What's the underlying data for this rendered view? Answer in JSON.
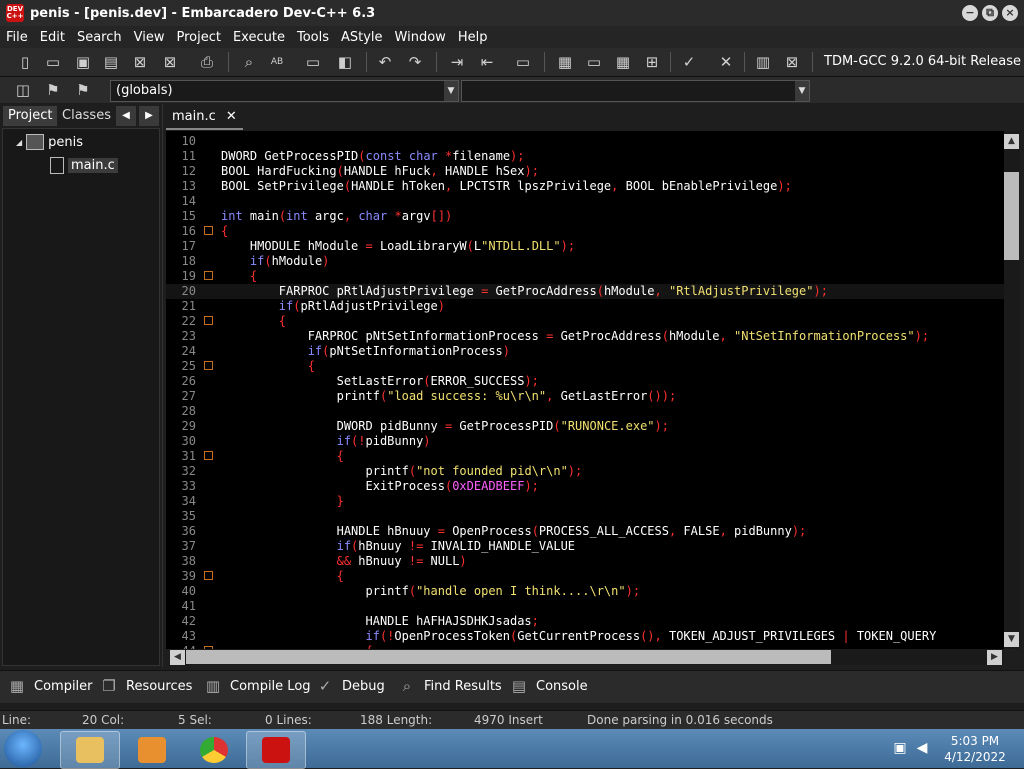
{
  "window": {
    "icon_text": "DEV C++",
    "title": "penis - [penis.dev] - Embarcadero Dev-C++ 6.3"
  },
  "menu": [
    "File",
    "Edit",
    "Search",
    "View",
    "Project",
    "Execute",
    "Tools",
    "AStyle",
    "Window",
    "Help"
  ],
  "toolbar": {
    "compiler": "TDM-GCC 9.2.0 64-bit Release",
    "icons": [
      "new-file-icon",
      "open-icon",
      "save-icon",
      "save-all-icon",
      "close-icon",
      "close-all-icon",
      "print-icon",
      "search-icon",
      "replace-icon",
      "goto-icon",
      "toggle-icon",
      "undo-icon",
      "redo-icon",
      "indent-icon",
      "unindent-icon",
      "comment-icon",
      "grid-icon",
      "window-icon",
      "tile-icon",
      "class-icon",
      "check-icon",
      "cross-icon",
      "chart-icon",
      "delete-icon"
    ]
  },
  "toolbar2": {
    "globals_value": "(globals)"
  },
  "left_panel": {
    "tabs": [
      "Project",
      "Classes"
    ],
    "tree": {
      "root": "penis",
      "child": "main.c"
    }
  },
  "editor": {
    "tab": "main.c",
    "lines": [
      {
        "n": "10",
        "html": ""
      },
      {
        "n": "11",
        "html": "DWORD GetProcessPID<span class='p'>(</span><span class='k'>const</span> <span class='k'>char</span> <span class='p'>*</span>filename<span class='p'>);</span>"
      },
      {
        "n": "12",
        "html": "BOOL HardFucking<span class='p'>(</span>HANDLE hFuck<span class='p'>,</span> HANDLE hSex<span class='p'>);</span>"
      },
      {
        "n": "13",
        "html": "BOOL SetPrivilege<span class='p'>(</span>HANDLE hToken<span class='p'>,</span> LPCTSTR lpszPrivilege<span class='p'>,</span> BOOL bEnablePrivilege<span class='p'>);</span>"
      },
      {
        "n": "14",
        "html": ""
      },
      {
        "n": "15",
        "html": "<span class='k'>int</span> main<span class='p'>(</span><span class='k'>int</span> argc<span class='p'>,</span> <span class='k'>char</span> <span class='p'>*</span>argv<span class='p'>[])</span>"
      },
      {
        "n": "16",
        "html": "<span class='p'>{</span>",
        "fold": true
      },
      {
        "n": "17",
        "html": "    HMODULE hModule <span class='p'>=</span> LoadLibraryW<span class='p'>(</span>L<span class='s'>\"NTDLL.DLL\"</span><span class='p'>);</span>"
      },
      {
        "n": "18",
        "html": "    <span class='k'>if</span><span class='p'>(</span>hModule<span class='p'>)</span>"
      },
      {
        "n": "19",
        "html": "    <span class='p'>{</span>",
        "fold": true
      },
      {
        "n": "20",
        "html": "        FARPROC pRtlAdjustPrivilege <span class='p'>=</span> GetProcAddress<span class='p'>(</span>hModule<span class='p'>,</span> <span class='s'>\"RtlAdjustPrivilege\"</span><span class='p'>);</span>",
        "current": true
      },
      {
        "n": "21",
        "html": "        <span class='k'>if</span><span class='p'>(</span>pRtlAdjustPrivilege<span class='p'>)</span>"
      },
      {
        "n": "22",
        "html": "        <span class='p'>{</span>",
        "fold": true
      },
      {
        "n": "23",
        "html": "            FARPROC pNtSetInformationProcess <span class='p'>=</span> GetProcAddress<span class='p'>(</span>hModule<span class='p'>,</span> <span class='s'>\"NtSetInformationProcess\"</span><span class='p'>);</span>"
      },
      {
        "n": "24",
        "html": "            <span class='k'>if</span><span class='p'>(</span>pNtSetInformationProcess<span class='p'>)</span>"
      },
      {
        "n": "25",
        "html": "            <span class='p'>{</span>",
        "fold": true
      },
      {
        "n": "26",
        "html": "                SetLastError<span class='p'>(</span>ERROR_SUCCESS<span class='p'>);</span>"
      },
      {
        "n": "27",
        "html": "                printf<span class='p'>(</span><span class='s'>\"load success: %u\\r\\n\"</span><span class='p'>,</span> GetLastError<span class='p'>());</span>"
      },
      {
        "n": "28",
        "html": ""
      },
      {
        "n": "29",
        "html": "                DWORD pidBunny <span class='p'>=</span> GetProcessPID<span class='p'>(</span><span class='s'>\"RUNONCE.exe\"</span><span class='p'>);</span>"
      },
      {
        "n": "30",
        "html": "                <span class='k'>if</span><span class='p'>(!</span>pidBunny<span class='p'>)</span>"
      },
      {
        "n": "31",
        "html": "                <span class='p'>{</span>",
        "fold": true
      },
      {
        "n": "32",
        "html": "                    printf<span class='p'>(</span><span class='s'>\"not founded pid\\r\\n\"</span><span class='p'>);</span>"
      },
      {
        "n": "33",
        "html": "                    ExitProcess<span class='p'>(</span><span class='n'>0xDEADBEEF</span><span class='p'>);</span>"
      },
      {
        "n": "34",
        "html": "                <span class='p'>}</span>"
      },
      {
        "n": "35",
        "html": ""
      },
      {
        "n": "36",
        "html": "                HANDLE hBnuuy <span class='p'>=</span> OpenProcess<span class='p'>(</span>PROCESS_ALL_ACCESS<span class='p'>,</span> FALSE<span class='p'>,</span> pidBunny<span class='p'>);</span>"
      },
      {
        "n": "37",
        "html": "                <span class='k'>if</span><span class='p'>(</span>hBnuuy <span class='p'>!=</span> INVALID_HANDLE_VALUE"
      },
      {
        "n": "38",
        "html": "                <span class='p'>&amp;&amp;</span> hBnuuy <span class='p'>!=</span> NULL<span class='p'>)</span>"
      },
      {
        "n": "39",
        "html": "                <span class='p'>{</span>",
        "fold": true
      },
      {
        "n": "40",
        "html": "                    printf<span class='p'>(</span><span class='s'>\"handle open I think....\\r\\n\"</span><span class='p'>);</span>"
      },
      {
        "n": "41",
        "html": ""
      },
      {
        "n": "42",
        "html": "                    HANDLE hAFHAJSDHKJsadas<span class='p'>;</span>"
      },
      {
        "n": "43",
        "html": "                    <span class='k'>if</span><span class='p'>(!</span>OpenProcessToken<span class='p'>(</span>GetCurrentProcess<span class='p'>(),</span> TOKEN_ADJUST_PRIVILEGES <span class='p'>|</span> TOKEN_QUERY"
      },
      {
        "n": "44",
        "html": "                    <span class='p'>{</span>",
        "fold": true
      }
    ]
  },
  "bottom_tabs": [
    {
      "label": "Compiler",
      "icon": "grid-icon"
    },
    {
      "label": "Resources",
      "icon": "resources-icon"
    },
    {
      "label": "Compile Log",
      "icon": "chart-icon"
    },
    {
      "label": "Debug",
      "icon": "check-icon"
    },
    {
      "label": "Find Results",
      "icon": "find-icon"
    },
    {
      "label": "Console",
      "icon": "console-icon"
    }
  ],
  "status": {
    "line": "Line:",
    "col": "20 Col:",
    "sel": "5 Sel:",
    "lines": "0 Lines:",
    "length": "188 Length:",
    "insert": "4970 Insert",
    "message": "Done parsing in 0.016 seconds"
  },
  "taskbar": {
    "time": "5:03 PM",
    "date": "4/12/2022"
  }
}
